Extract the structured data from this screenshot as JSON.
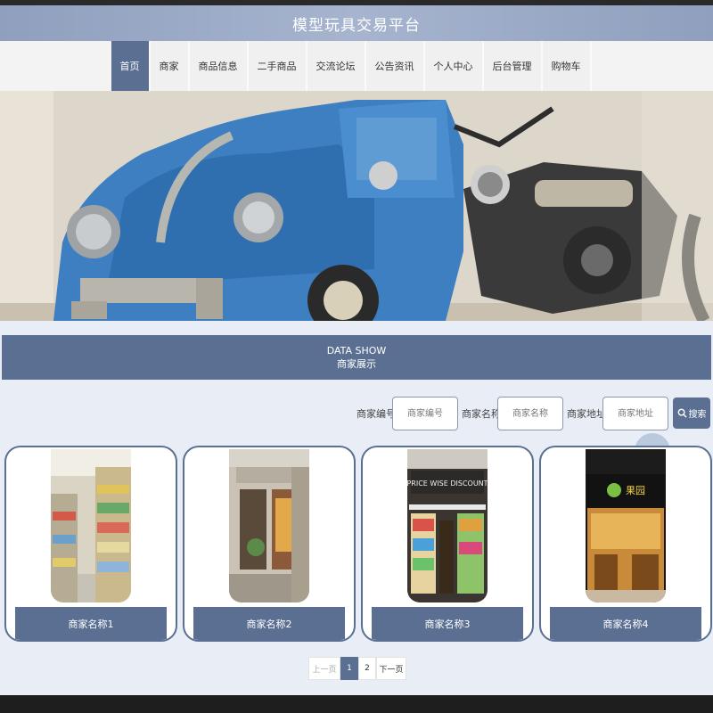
{
  "header": {
    "title": "模型玩具交易平台"
  },
  "nav": {
    "items": [
      {
        "label": "首页",
        "active": true
      },
      {
        "label": "商家"
      },
      {
        "label": "商品信息"
      },
      {
        "label": "二手商品"
      },
      {
        "label": "交流论坛"
      },
      {
        "label": "公告资讯"
      },
      {
        "label": "个人中心"
      },
      {
        "label": "后台管理"
      },
      {
        "label": "购物车"
      }
    ]
  },
  "section": {
    "title_en": "DATA SHOW",
    "title_cn": "商家展示"
  },
  "search": {
    "fields": [
      {
        "label": "商家编号",
        "placeholder": "商家编号"
      },
      {
        "label": "商家名称",
        "placeholder": "商家名称"
      },
      {
        "label": "商家地址",
        "placeholder": "商家地址"
      }
    ],
    "button_label": "搜索",
    "button_icon": "search-icon"
  },
  "cards": [
    {
      "name": "商家名称1"
    },
    {
      "name": "商家名称2"
    },
    {
      "name": "商家名称3"
    },
    {
      "name": "商家名称4"
    }
  ],
  "store3_sign": "PRICE WISE DISCOUNT",
  "store4_sign": "果园",
  "pagination": {
    "prev": "上一页",
    "pages": [
      "1",
      "2"
    ],
    "current": "1",
    "next": "下一页"
  },
  "colors": {
    "accent": "#5b6f93",
    "header_bg": "#a6b4cf",
    "page_bg": "#e9eef6"
  }
}
